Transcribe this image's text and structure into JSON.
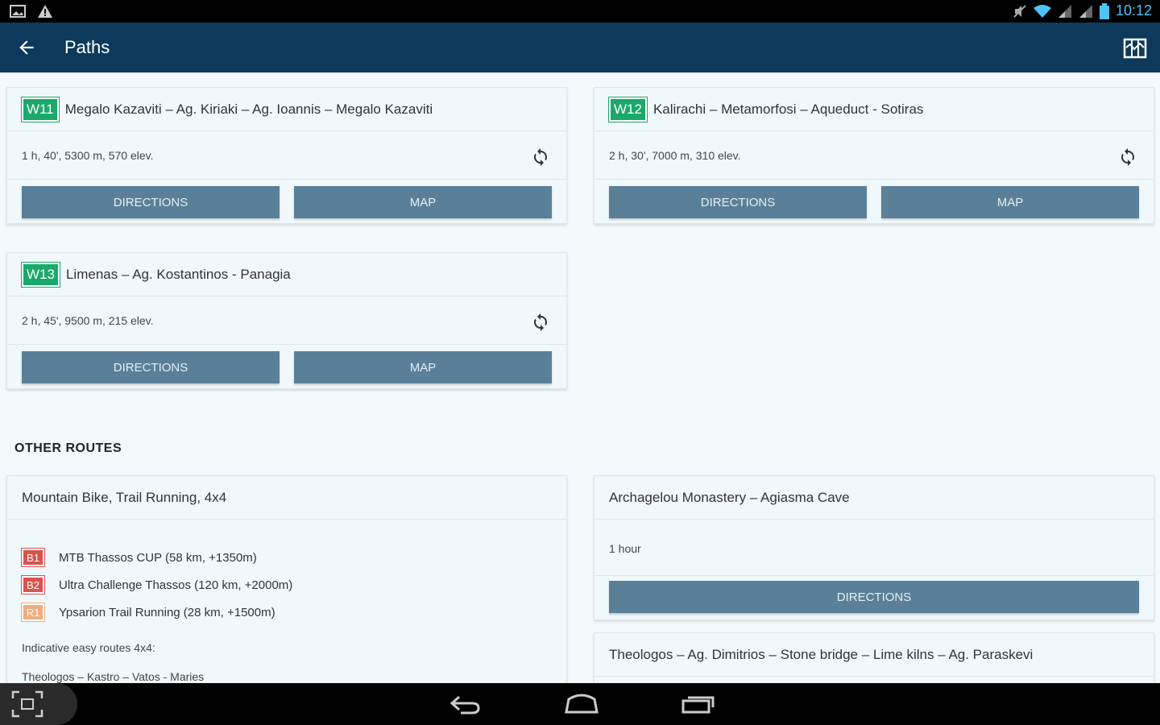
{
  "status_bar": {
    "time": "10:12"
  },
  "app_bar": {
    "title": "Paths"
  },
  "paths": [
    {
      "code": "W11",
      "title": "Megalo Kazaviti – Ag. Kiriaki – Ag. Ioannis – Megalo Kazaviti",
      "info": "1 h, 40', 5300 m, 570 elev.",
      "directions_label": "DIRECTIONS",
      "map_label": "MAP"
    },
    {
      "code": "W12",
      "title": "Kalirachi – Metamorfosi – Aqueduct - Sotiras",
      "info": "2 h, 30', 7000 m, 310 elev.",
      "directions_label": "DIRECTIONS",
      "map_label": "MAP"
    },
    {
      "code": "W13",
      "title": "Limenas – Ag. Kostantinos - Panagia",
      "info": "2 h, 45', 9500 m, 215 elev.",
      "directions_label": "DIRECTIONS",
      "map_label": "MAP"
    }
  ],
  "other_routes": {
    "section_title": "OTHER ROUTES",
    "mtb": {
      "title": "Mountain Bike, Trail Running, 4x4",
      "items": [
        {
          "code": "B1",
          "color": "#d9534f",
          "text": "MTB Thassos CUP (58 km, +1350m)"
        },
        {
          "code": "B2",
          "color": "#d9534f",
          "text": "Ultra Challenge Thassos (120 km, +2000m)"
        },
        {
          "code": "R1",
          "color": "#f0ad7e",
          "text": "Ypsarion Trail Running (28 km, +1500m)"
        }
      ],
      "note": "Indicative easy routes 4x4:",
      "route_line": "Theologos – Kastro – Vatos - Maries"
    },
    "monastery": {
      "title": "Archagelou Monastery – Agiasma Cave",
      "info": "1 hour",
      "directions_label": "DIRECTIONS"
    },
    "theologos": {
      "title": "Theologos – Ag. Dimitrios – Stone bridge – Lime kilns – Ag. Paraskevi"
    }
  }
}
